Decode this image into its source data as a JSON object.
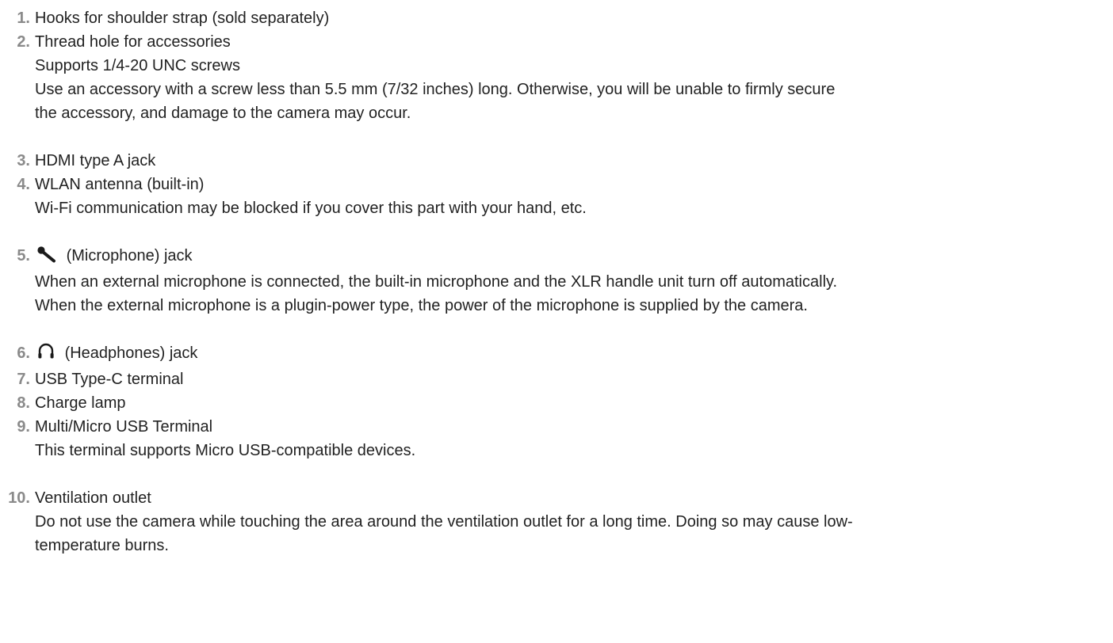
{
  "items": [
    {
      "num": "1.",
      "label": "Hooks for shoulder strap (sold separately)"
    },
    {
      "num": "2.",
      "label": "Thread hole for accessories",
      "desc": [
        "Supports 1/4-20 UNC screws",
        "Use an accessory with a screw less than 5.5 mm (7/32 inches) long. Otherwise, you will be unable to firmly secure",
        "the accessory, and damage to the camera may occur."
      ]
    },
    {
      "num": "3.",
      "label": "HDMI type A jack"
    },
    {
      "num": "4.",
      "label": "WLAN antenna (built-in)",
      "desc": [
        "Wi-Fi communication may be blocked if you cover this part with your hand, etc."
      ]
    },
    {
      "num": "5.",
      "icon": "microphone-icon",
      "label": "(Microphone) jack",
      "desc": [
        "When an external microphone is connected, the built-in microphone and the XLR handle unit turn off automatically.",
        "When the external microphone is a plugin-power type, the power of the microphone is supplied by the camera."
      ]
    },
    {
      "num": "6.",
      "icon": "headphones-icon",
      "label": "(Headphones) jack"
    },
    {
      "num": "7.",
      "label": "USB Type-C terminal"
    },
    {
      "num": "8.",
      "label": "Charge lamp"
    },
    {
      "num": "9.",
      "label": "Multi/Micro USB Terminal",
      "desc": [
        "This terminal supports Micro USB-compatible devices."
      ]
    },
    {
      "num": "10.",
      "label": "Ventilation outlet",
      "desc": [
        "Do not use the camera while touching the area around the ventilation outlet for a long time. Doing so may cause low-",
        "temperature burns."
      ]
    }
  ]
}
